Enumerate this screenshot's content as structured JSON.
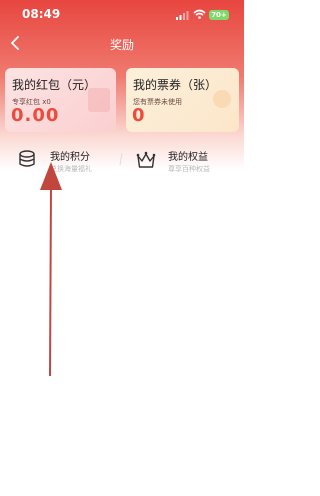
{
  "status_bar": {
    "time": "08:49",
    "battery": "70+"
  },
  "nav": {
    "title": "奖励"
  },
  "cards": {
    "hongbao": {
      "title": "我的红包（元）",
      "sub": "专享红包 x0",
      "value": "0.00"
    },
    "ticket": {
      "title": "我的票券（张）",
      "sub": "您有票券未使用",
      "value": "0"
    }
  },
  "features": {
    "points": {
      "title": "我的积分",
      "sub": "兑换海量福礼"
    },
    "rights": {
      "title": "我的权益",
      "sub": "尊享百种权益"
    }
  },
  "colors": {
    "accent": "#e7463f",
    "value_red": "#ee4b3b",
    "arrow": "#c1473e"
  }
}
